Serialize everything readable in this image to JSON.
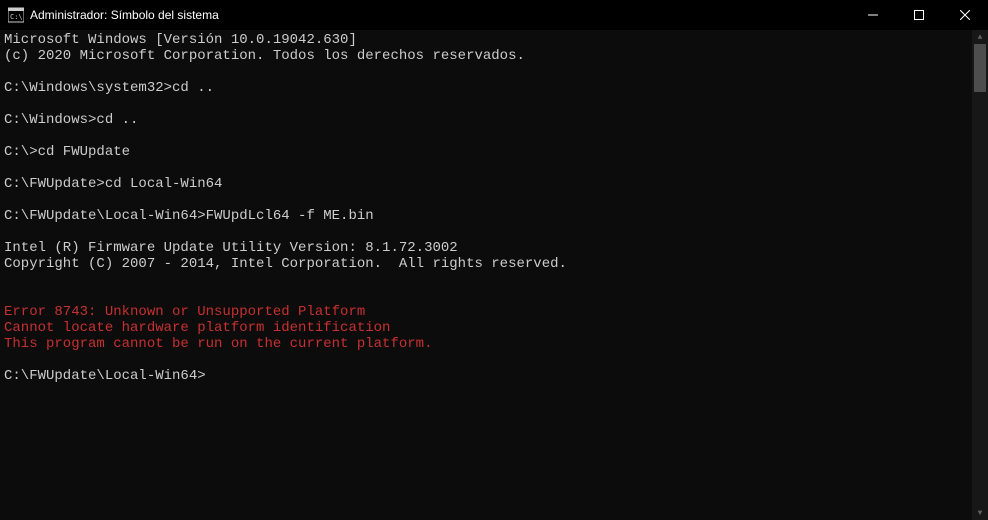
{
  "titlebar": {
    "title": "Administrador: Símbolo del sistema"
  },
  "terminal": {
    "lines": [
      {
        "text": "Microsoft Windows [Versión 10.0.19042.630]",
        "error": false
      },
      {
        "text": "(c) 2020 Microsoft Corporation. Todos los derechos reservados.",
        "error": false
      },
      {
        "text": "",
        "error": false
      },
      {
        "text": "C:\\Windows\\system32>cd ..",
        "error": false
      },
      {
        "text": "",
        "error": false
      },
      {
        "text": "C:\\Windows>cd ..",
        "error": false
      },
      {
        "text": "",
        "error": false
      },
      {
        "text": "C:\\>cd FWUpdate",
        "error": false
      },
      {
        "text": "",
        "error": false
      },
      {
        "text": "C:\\FWUpdate>cd Local-Win64",
        "error": false
      },
      {
        "text": "",
        "error": false
      },
      {
        "text": "C:\\FWUpdate\\Local-Win64>FWUpdLcl64 -f ME.bin",
        "error": false
      },
      {
        "text": "",
        "error": false
      },
      {
        "text": "Intel (R) Firmware Update Utility Version: 8.1.72.3002",
        "error": false
      },
      {
        "text": "Copyright (C) 2007 - 2014, Intel Corporation.  All rights reserved.",
        "error": false
      },
      {
        "text": "",
        "error": false
      },
      {
        "text": "",
        "error": false
      },
      {
        "text": "Error 8743: Unknown or Unsupported Platform",
        "error": true
      },
      {
        "text": "Cannot locate hardware platform identification",
        "error": true
      },
      {
        "text": "This program cannot be run on the current platform.",
        "error": true
      },
      {
        "text": "",
        "error": false
      }
    ],
    "prompt": "C:\\FWUpdate\\Local-Win64>"
  }
}
